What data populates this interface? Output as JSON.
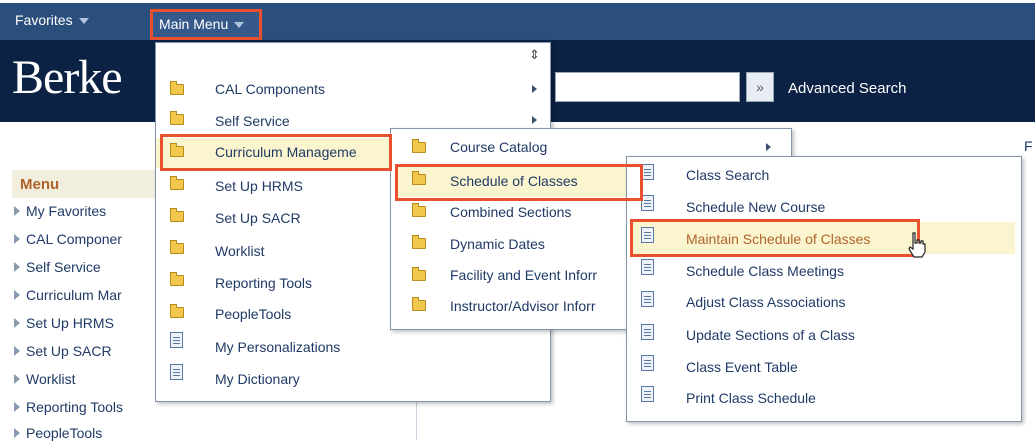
{
  "topbar": {
    "favorites": "Favorites",
    "main_menu": "Main Menu"
  },
  "brand": {
    "text": "Berke"
  },
  "search": {
    "go": "»",
    "advanced": "Advanced Search"
  },
  "right_edge_letter": "F",
  "leftnav": {
    "heading": "Menu",
    "items": [
      "My Favorites",
      "CAL Componer",
      "Self Service",
      "Curriculum Mar",
      "Set Up HRMS",
      "Set Up SACR",
      "Worklist",
      "Reporting Tools",
      "PeopleTools"
    ]
  },
  "menu1": {
    "scroll_glyph": "⇕",
    "items": [
      {
        "label": "CAL Components",
        "icon": "folder-icon",
        "submenu": true
      },
      {
        "label": "Self Service",
        "icon": "folder-icon",
        "submenu": true
      },
      {
        "label": "Curriculum Manageme",
        "icon": "folder-icon",
        "submenu": false
      },
      {
        "label": "Set Up HRMS",
        "icon": "folder-icon",
        "submenu": false
      },
      {
        "label": "Set Up SACR",
        "icon": "folder-icon",
        "submenu": false
      },
      {
        "label": "Worklist",
        "icon": "folder-icon",
        "submenu": false
      },
      {
        "label": "Reporting Tools",
        "icon": "folder-icon",
        "submenu": false
      },
      {
        "label": "PeopleTools",
        "icon": "folder-icon",
        "submenu": false
      },
      {
        "label": "My Personalizations",
        "icon": "document-icon",
        "submenu": false
      },
      {
        "label": "My Dictionary",
        "icon": "document-icon",
        "submenu": false
      }
    ]
  },
  "menu2": {
    "items": [
      {
        "label": "Course Catalog",
        "icon": "folder-icon",
        "submenu": true
      },
      {
        "label": "Schedule of Classes",
        "icon": "folder-icon",
        "submenu": false
      },
      {
        "label": "Combined Sections",
        "icon": "folder-icon",
        "submenu": false
      },
      {
        "label": "Dynamic Dates",
        "icon": "folder-icon",
        "submenu": false
      },
      {
        "label": "Facility and Event Inforr",
        "icon": "folder-icon",
        "submenu": false
      },
      {
        "label": "Instructor/Advisor Inforr",
        "icon": "folder-icon",
        "submenu": false
      }
    ]
  },
  "menu3": {
    "items": [
      {
        "label": "Class Search",
        "icon": "document-icon"
      },
      {
        "label": "Schedule New Course",
        "icon": "document-icon"
      },
      {
        "label": "Maintain Schedule of Classes",
        "icon": "document-icon"
      },
      {
        "label": "Schedule Class Meetings",
        "icon": "document-icon"
      },
      {
        "label": "Adjust Class Associations",
        "icon": "document-icon"
      },
      {
        "label": "Update Sections of a Class",
        "icon": "document-icon"
      },
      {
        "label": "Class Event Table",
        "icon": "document-icon"
      },
      {
        "label": "Print Class Schedule",
        "icon": "document-icon"
      }
    ]
  },
  "colors": {
    "topbar": "#2a4f7c",
    "banner": "#0b2244",
    "highlight": "#fbf5cf",
    "callout": "#e8502e",
    "accent_text": "#b0642b"
  }
}
